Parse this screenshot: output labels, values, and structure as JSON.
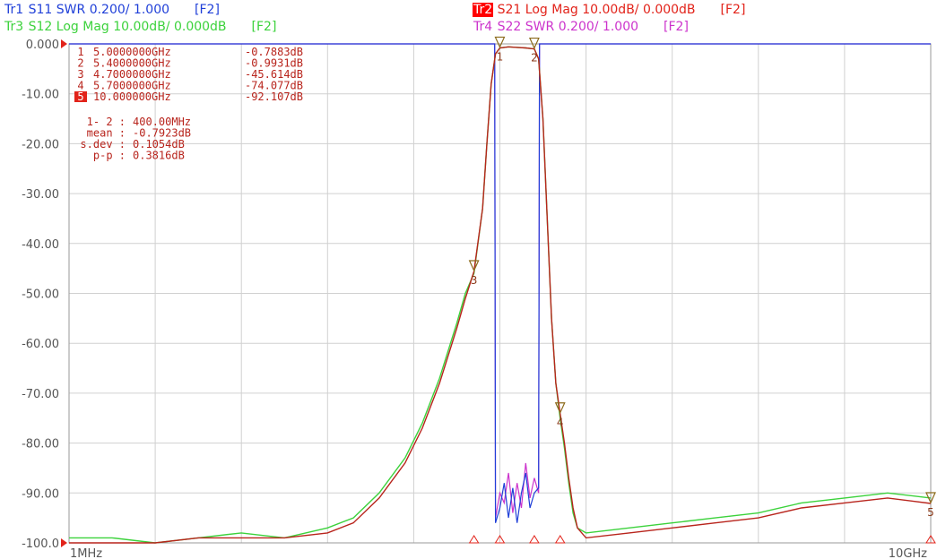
{
  "traces": {
    "tr1": {
      "name": "Tr1",
      "param": "S11",
      "format": "SWR 0.200/ 1.000",
      "channel": "[F2]",
      "color": "#1f3fd8"
    },
    "tr2": {
      "name": "Tr2",
      "param": "S21",
      "format": "Log Mag 10.00dB/ 0.000dB",
      "channel": "[F2]",
      "color": "#e2231a"
    },
    "tr3": {
      "name": "Tr3",
      "param": "S12",
      "format": "Log Mag 10.00dB/ 0.000dB",
      "channel": "[F2]",
      "color": "#3cd23c"
    },
    "tr4": {
      "name": "Tr4",
      "param": "S22",
      "format": "SWR 0.200/ 1.000",
      "channel": "[F2]",
      "color": "#cc33cc"
    }
  },
  "markers": [
    {
      "id": "1",
      "freq": "5.0000000GHz",
      "value": "-0.7883dB",
      "active": false
    },
    {
      "id": "2",
      "freq": "5.4000000GHz",
      "value": "-0.9931dB",
      "active": false
    },
    {
      "id": "3",
      "freq": "4.7000000GHz",
      "value": "-45.614dB",
      "active": false
    },
    {
      "id": "4",
      "freq": "5.7000000GHz",
      "value": "-74.077dB",
      "active": false
    },
    {
      "id": "5",
      "freq": "10.000000GHz",
      "value": "-92.107dB",
      "active": true
    }
  ],
  "stats": [
    {
      "label": "1- 2 :",
      "value": "400.00MHz"
    },
    {
      "label": "mean :",
      "value": "-0.7923dB"
    },
    {
      "label": "s.dev :",
      "value": "0.1054dB"
    },
    {
      "label": "p-p :",
      "value": "0.3816dB"
    }
  ],
  "chart_data": {
    "type": "line",
    "xlabel": "",
    "ylabel": "",
    "x_start_label": "1MHz",
    "x_stop_label": "10GHz",
    "x_unit": "GHz",
    "x_scale": "linear",
    "xlim": [
      0.001,
      10.0
    ],
    "ylim": [
      -100,
      0
    ],
    "grid": true,
    "y_ticks": [
      "0.000",
      "-10.00",
      "-20.00",
      "-30.00",
      "-40.00",
      "-50.00",
      "-60.00",
      "-70.00",
      "-80.00",
      "-90.00",
      "-100.0"
    ],
    "colors": {
      "s21": "#b8241c",
      "s12": "#3cd23c",
      "swr_s11": "#1f3fd8",
      "swr_s22": "#cc33cc",
      "grid": "#d0d0d0",
      "ref_line": "#cc33cc"
    },
    "series": [
      {
        "key": "s21",
        "x": [
          0.001,
          0.5,
          1.0,
          1.5,
          2.0,
          2.5,
          3.0,
          3.3,
          3.6,
          3.9,
          4.1,
          4.3,
          4.5,
          4.6,
          4.7,
          4.8,
          4.85,
          4.9,
          4.95,
          5.0,
          5.1,
          5.2,
          5.3,
          5.4,
          5.45,
          5.5,
          5.55,
          5.6,
          5.65,
          5.7,
          5.75,
          5.8,
          5.85,
          5.9,
          6.0,
          6.5,
          7.0,
          7.5,
          8.0,
          8.5,
          9.0,
          9.5,
          10.0
        ],
        "y": [
          -100,
          -100,
          -100,
          -99,
          -99,
          -99,
          -98,
          -96,
          -91,
          -84,
          -77,
          -68,
          -57,
          -51,
          -45.6,
          -33,
          -20,
          -8,
          -2,
          -0.8,
          -0.6,
          -0.7,
          -0.8,
          -1.0,
          -3,
          -15,
          -35,
          -55,
          -68,
          -74.1,
          -80,
          -87,
          -93,
          -97,
          -99,
          -98,
          -97,
          -96,
          -95,
          -93,
          -92,
          -91,
          -92.1
        ]
      },
      {
        "key": "s12",
        "x": [
          0.001,
          0.5,
          1.0,
          1.5,
          2.0,
          2.5,
          3.0,
          3.3,
          3.6,
          3.9,
          4.1,
          4.3,
          4.5,
          4.6,
          4.7,
          4.8,
          4.85,
          4.9,
          4.95,
          5.0,
          5.1,
          5.2,
          5.3,
          5.4,
          5.45,
          5.5,
          5.55,
          5.6,
          5.65,
          5.7,
          5.75,
          5.8,
          5.85,
          5.9,
          6.0,
          6.5,
          7.0,
          7.5,
          8.0,
          8.5,
          9.0,
          9.5,
          10.0
        ],
        "y": [
          -99,
          -99,
          -100,
          -99,
          -98,
          -99,
          -97,
          -95,
          -90,
          -83,
          -76,
          -67,
          -56,
          -50,
          -46,
          -33,
          -20,
          -8,
          -2,
          -0.8,
          -0.6,
          -0.7,
          -0.8,
          -1.0,
          -3,
          -15,
          -35,
          -55,
          -68,
          -75,
          -81,
          -88,
          -94,
          -97,
          -98,
          -97,
          -96,
          -95,
          -94,
          -92,
          -91,
          -90,
          -91
        ]
      },
      {
        "key": "swr_s11",
        "x": [
          0.001,
          4.94,
          4.95,
          5.0,
          5.05,
          5.1,
          5.15,
          5.2,
          5.25,
          5.3,
          5.35,
          5.4,
          5.45,
          5.46,
          10.0
        ],
        "y": [
          0,
          0,
          -96,
          -93,
          -88,
          -95,
          -89,
          -96,
          -90,
          -86,
          -93,
          -90,
          -89,
          0,
          0
        ]
      },
      {
        "key": "swr_s22",
        "x": [
          0.001,
          4.94,
          4.95,
          5.0,
          5.05,
          5.1,
          5.15,
          5.2,
          5.25,
          5.3,
          5.35,
          5.4,
          5.45,
          5.46,
          10.0
        ],
        "y": [
          0,
          0,
          -95,
          -90,
          -92,
          -86,
          -94,
          -88,
          -93,
          -84,
          -91,
          -87,
          -90,
          0,
          0
        ]
      }
    ],
    "marker_positions": [
      {
        "id": "1",
        "x": 5.0,
        "y": -0.8
      },
      {
        "id": "2",
        "x": 5.4,
        "y": -1.0
      },
      {
        "id": "3",
        "x": 4.7,
        "y": -45.6
      },
      {
        "id": "4",
        "x": 5.7,
        "y": -74.1
      },
      {
        "id": "5",
        "x": 10.0,
        "y": -92.1
      }
    ]
  }
}
